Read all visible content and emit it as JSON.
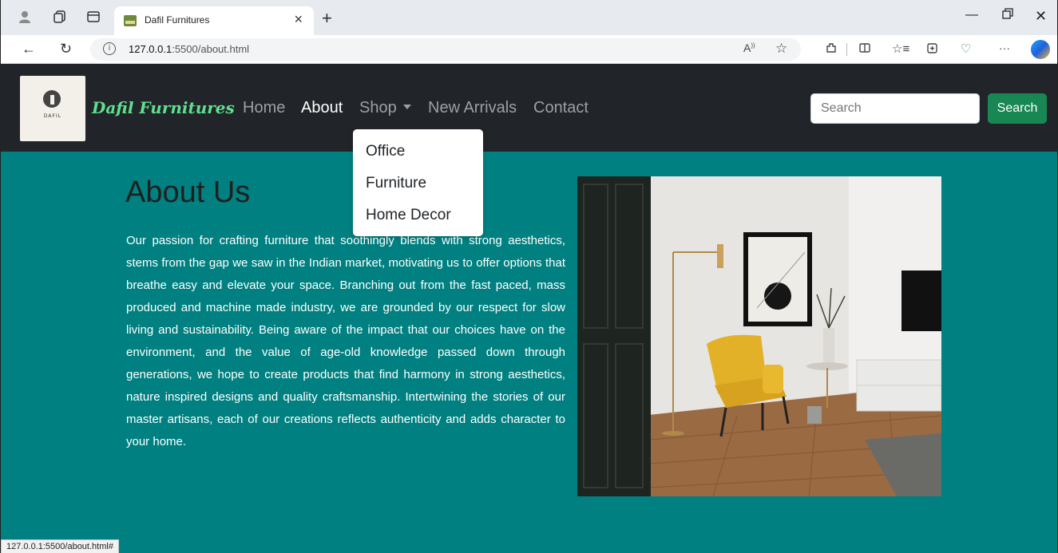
{
  "browser": {
    "tab_title": "Dafil Furnitures",
    "url_host": "127.0.0.1",
    "url_rest": ":5500/about.html",
    "status_url": "127.0.0.1:5500/about.html#"
  },
  "navbar": {
    "brand": "Dafil Furnitures",
    "logo_text": "DAFIL",
    "links": [
      "Home",
      "About",
      "Shop",
      "New Arrivals",
      "Contact"
    ],
    "active": "About",
    "search_placeholder": "Search",
    "search_button": "Search",
    "colors": {
      "bg": "#212529",
      "brand": "#5fe08f",
      "button": "#198754"
    }
  },
  "dropdown": {
    "items": [
      "Office",
      "Furniture",
      "Home Decor"
    ]
  },
  "about": {
    "title": "About Us",
    "text": "Our passion for crafting furniture that soothingly blends with strong aesthetics, stems from the gap we saw in the Indian market, motivating us to offer options that breathe easy and elevate your space. Branching out from the fast paced, mass produced and machine made industry, we are grounded by our respect for slow living and sustainability. Being aware of the impact that our choices have on the environment, and the value of age-old knowledge passed down through generations, we hope to create products that find harmony in strong aesthetics, nature inspired designs and quality craftsmanship. Intertwining the stories of our master artisans, each of our creations reflects authenticity and adds character to your home.",
    "bg_color": "#008080"
  },
  "icons": [
    "profile-icon",
    "workspaces-icon",
    "tab-actions-icon",
    "back-icon",
    "refresh-icon",
    "info-icon",
    "read-aloud-icon",
    "favorite-icon",
    "extensions-icon",
    "split-screen-icon",
    "favorites-icon",
    "collections-icon",
    "health-icon",
    "more-icon",
    "copilot-icon"
  ]
}
